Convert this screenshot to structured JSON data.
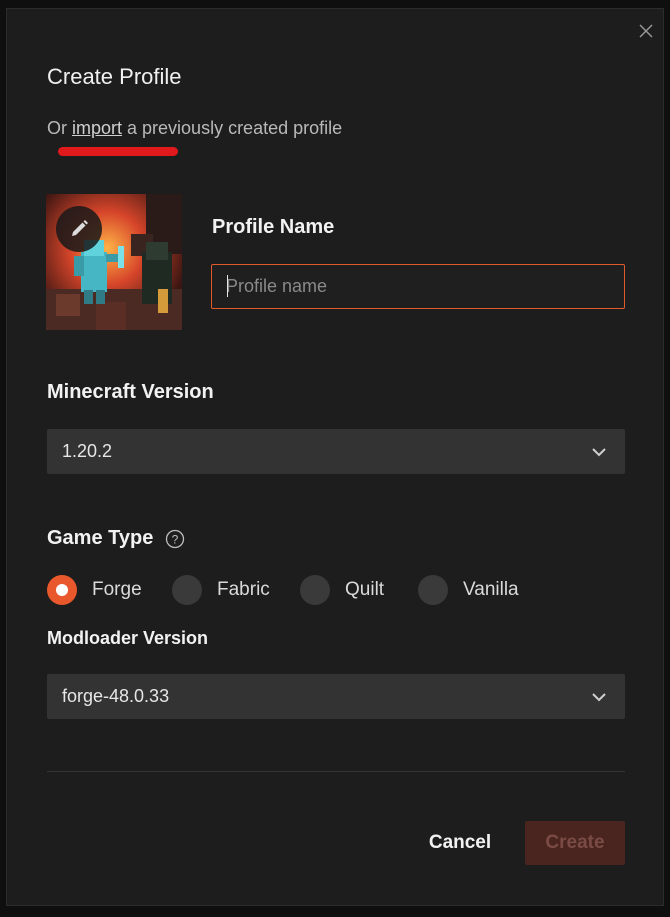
{
  "dialog": {
    "title": "Create Profile",
    "close_icon": "close-icon"
  },
  "import_line": {
    "prefix": "Or ",
    "link_label": "import",
    "suffix": " a previously created profile",
    "annotation_color": "#e0191c"
  },
  "profile": {
    "avatar_icon": "edit-pencil-icon",
    "name_label": "Profile Name",
    "name_value": "",
    "name_placeholder": "Profile name"
  },
  "minecraft_version": {
    "label": "Minecraft Version",
    "selected": "1.20.2",
    "chevron_icon": "chevron-down-icon"
  },
  "game_type": {
    "label": "Game Type",
    "help_icon": "question-circle-icon",
    "options": [
      {
        "label": "Forge",
        "checked": true
      },
      {
        "label": "Fabric",
        "checked": false
      },
      {
        "label": "Quilt",
        "checked": false
      },
      {
        "label": "Vanilla",
        "checked": false
      }
    ]
  },
  "modloader_version": {
    "label": "Modloader Version",
    "selected": "forge-48.0.33",
    "chevron_icon": "chevron-down-icon"
  },
  "actions": {
    "cancel_label": "Cancel",
    "create_label": "Create"
  },
  "colors": {
    "accent": "#e8582c",
    "dialog_bg": "#1d1d1d",
    "select_bg": "#333333",
    "create_disabled_bg": "#4a2520"
  }
}
